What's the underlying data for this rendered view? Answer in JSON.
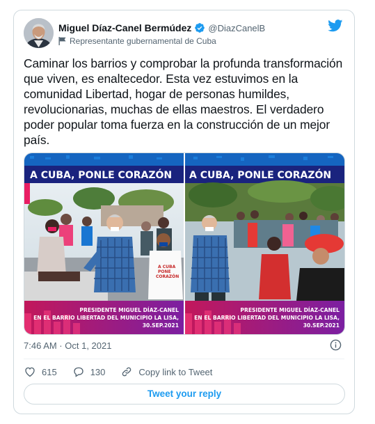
{
  "tweet": {
    "author_name": "Miguel Díaz-Canel Bermúdez",
    "handle": "@DiazCanelB",
    "label": "Representante gubernamental de Cuba",
    "text": "Caminar los barrios y comprobar la profunda transformación que viven, es enaltecedor. Esta vez estuvimos en la comunidad Libertad, hogar de personas humildes, revolucionarias, muchas de ellas maestros. El verdadero poder popular toma fuerza en la construcción de un mejor país.",
    "timestamp": "7:46 AM · Oct 1, 2021"
  },
  "media": {
    "banner": "A CUBA, PONLE CORAZÓN",
    "caption_line1": "PRESIDENTE MIGUEL DÍAZ-CANEL",
    "caption_line2": "EN EL BARRIO LIBERTAD DEL MUNICIPIO LA LISA,",
    "caption_date": "30.SEP.2021",
    "shirt_text": "A CUBA PONE CORAZÓN"
  },
  "actions": {
    "likes": "615",
    "replies": "130",
    "copy_link": "Copy link to Tweet"
  },
  "reply_button": "Tweet your reply",
  "colors": {
    "accent": "#1d9bf0",
    "text": "#0f1419",
    "muted": "#536471",
    "border": "#cfd9de"
  },
  "icons": [
    "verified-badge-icon",
    "flag-icon",
    "twitter-bird-icon",
    "info-icon",
    "heart-icon",
    "reply-bubble-icon",
    "link-icon"
  ]
}
